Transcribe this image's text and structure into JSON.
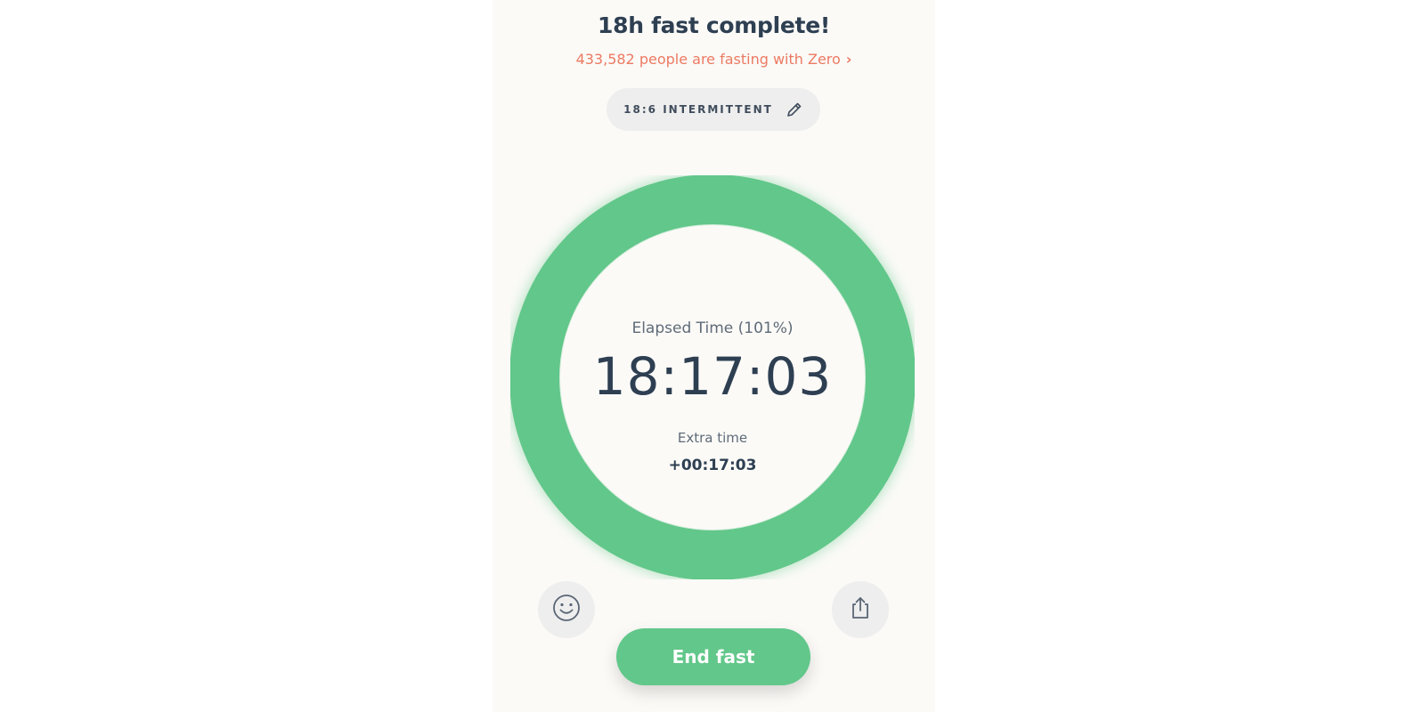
{
  "header": {
    "title": "18h fast complete!",
    "community_text": "433,582 people are fasting with Zero",
    "community_chevron": "›"
  },
  "plan": {
    "label": "18:6 INTERMITTENT",
    "edit_icon": "pencil-icon"
  },
  "timer": {
    "elapsed_label": "Elapsed Time (101%)",
    "elapsed_time": "18:17:03",
    "progress_percent": 101,
    "extra_label": "Extra time",
    "extra_value": "+00:17:03"
  },
  "actions": {
    "mood_icon": "smiley-icon",
    "share_icon": "share-icon",
    "end_label": "End fast"
  },
  "colors": {
    "ring": "#62c78a",
    "accent": "#ec7a62",
    "text_dark": "#2e3f52",
    "background": "#fbfaf7"
  }
}
